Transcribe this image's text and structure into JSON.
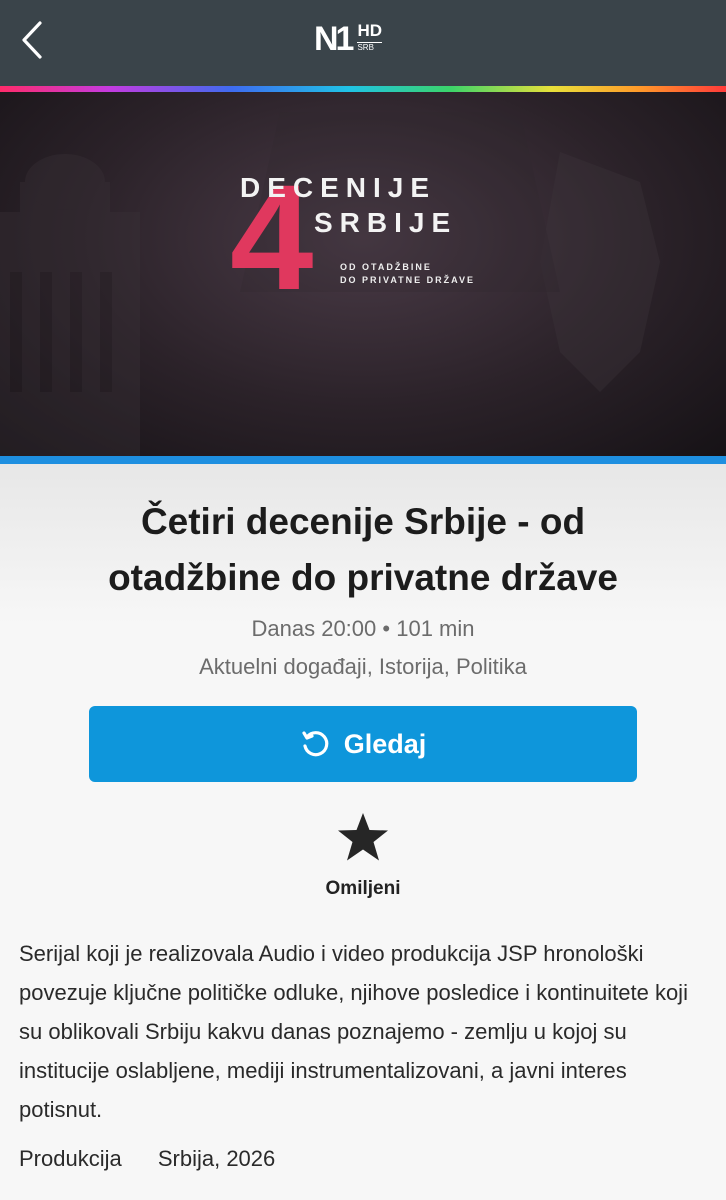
{
  "header": {
    "back_icon": "chevron-left-icon",
    "logo_main": "N1",
    "logo_hd": "HD",
    "logo_sub": "SRB"
  },
  "hero": {
    "number": "4",
    "line1": "DECENIJE",
    "line2": "SRBIJE",
    "tagline1": "OD OTADŽBINE",
    "tagline2": "DO PRIVATNE DRŽAVE"
  },
  "program": {
    "title_line1": "Četiri decenije Srbije - od",
    "title_line2": "otadžbine do privatne države",
    "time": "Danas 20:00",
    "separator": "•",
    "duration": "101 min",
    "genres": "Aktuelni događaji, Istorija, Politika"
  },
  "actions": {
    "watch_label": "Gledaj",
    "watch_icon": "replay-icon",
    "favorite_label": "Omiljeni",
    "favorite_icon": "star-icon"
  },
  "description": "Serijal koji je realizovala Audio i video produkcija JSP hronološki povezuje ključne političke odluke, njihove posledice i kontinuitete koji su oblikovali Srbiju kakvu danas poznajemo - zemlju u kojoj su institucije oslabljene, mediji instrumentalizovani, a javni interes potisnut.",
  "production": {
    "label": "Produkcija",
    "value": "Srbija, 2026"
  },
  "colors": {
    "header_bg": "#3a444a",
    "accent": "#0e96db",
    "poster_red": "#e0385e"
  }
}
